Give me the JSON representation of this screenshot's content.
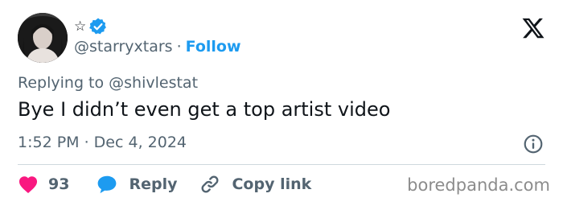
{
  "post": {
    "display_name": "☆",
    "handle": "@starryxtars",
    "separator": "·",
    "follow_label": "Follow",
    "replying_to": "Replying to @shivlestat",
    "text": "Bye I didn’t even get a top artist video",
    "timestamp": "1:52 PM · Dec 4, 2024"
  },
  "actions": {
    "like_count": "93",
    "reply_label": "Reply",
    "copy_label": "Copy link"
  },
  "icons": {
    "verified": "verified-badge-icon",
    "logo": "x-logo-icon",
    "info": "info-icon",
    "like": "heart-icon",
    "reply": "speech-bubble-icon",
    "copy": "link-icon"
  },
  "colors": {
    "accent": "#1d9bf0",
    "like": "#f91880",
    "muted_text": "#536471",
    "text": "#0f1419",
    "divider": "#cfd9de"
  },
  "watermark": "boredpanda.com"
}
